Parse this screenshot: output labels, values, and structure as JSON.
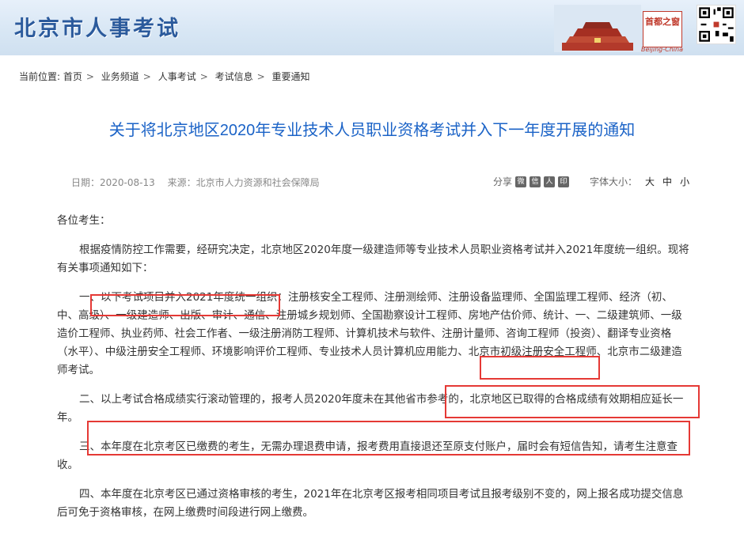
{
  "header": {
    "site_title": "北京市人事考试",
    "brand_name": "首都之窗",
    "brand_sub": "Beijing-China",
    "qr_label": "二维码"
  },
  "breadcrumb": {
    "prefix": "当前位置:",
    "items": [
      "首页",
      "业务频道",
      "人事考试",
      "考试信息",
      "重要通知"
    ]
  },
  "article": {
    "title": "关于将北京地区2020年专业技术人员职业资格考试并入下一年度开展的通知",
    "date": "日期：2020-08-13",
    "source": "来源：北京市人力资源和社会保障局",
    "share_label": "分享",
    "font_size_label": "字体大小：",
    "font_sizes": [
      "大",
      "中",
      "小"
    ],
    "greeting": "各位考生：",
    "para1": "根据疫情防控工作需要，经研究决定，北京地区2020年度一级建造师等专业技术人员职业资格考试并入2021年度统一组织。现将有关事项通知如下：",
    "para2": "一、以下考试项目并入2021年度统一组织：注册核安全工程师、注册测绘师、注册设备监理师、全国监理工程师、经济（初、中、高级）、一级建造师、出版、审计、通信、注册城乡规划师、全国勘察设计工程师、房地产估价师、统计、一、二级建筑师、一级造价工程师、执业药师、社会工作者、一级注册消防工程师、计算机技术与软件、注册计量师、咨询工程师（投资）、翻译专业资格（水平）、中级注册安全工程师、环境影响评价工程师、专业技术人员计算机应用能力、北京市初级注册安全工程师、北京市二级建造师考试。",
    "para3": "二、以上考试合格成绩实行滚动管理的，报考人员2020年度未在其他省市参考的，北京地区已取得的合格成绩有效期相应延长一年。",
    "para4": "三、本年度在北京考区已缴费的考生，无需办理退费申请，报考费用直接退还至原支付账户，届时会有短信告知，请考生注意查收。",
    "para5": "四、本年度在北京考区已通过资格审核的考生，2021年在北京考区报考相同项目考试且报考级别不变的，网上报名成功提交信息后可免于资格审核，在网上缴费时间段进行网上缴费。"
  },
  "colors": {
    "title_blue": "#1b63c7",
    "header_blue": "#2b5a9c",
    "highlight_red": "#e53935"
  }
}
